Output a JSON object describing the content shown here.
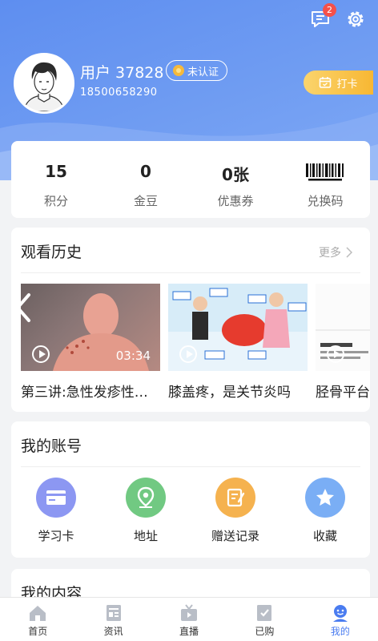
{
  "header": {
    "message_badge": "2",
    "username": "用户 37828",
    "verify_label": "未认证",
    "phone": "18500658290",
    "checkin_label": "打卡"
  },
  "stats": [
    {
      "value": "15",
      "label": "积分"
    },
    {
      "value": "0",
      "label": "金豆"
    },
    {
      "value": "0张",
      "label": "优惠券"
    },
    {
      "value": "",
      "label": "兑换码"
    }
  ],
  "history": {
    "title": "观看历史",
    "more_label": "更多",
    "items": [
      {
        "title": "第三讲:急性发疹性疾病",
        "duration": "03:34"
      },
      {
        "title": "膝盖疼，是关节炎吗",
        "duration": ""
      },
      {
        "title": "胫骨平台骨折",
        "duration": ""
      }
    ]
  },
  "account": {
    "title": "我的账号",
    "items": [
      {
        "label": "学习卡",
        "icon": "card-icon",
        "color": "#8c97f2"
      },
      {
        "label": "地址",
        "icon": "location-icon",
        "color": "#71c982"
      },
      {
        "label": "赠送记录",
        "icon": "note-icon",
        "color": "#f5b24f"
      },
      {
        "label": "收藏",
        "icon": "star-icon",
        "color": "#7aaef5"
      }
    ]
  },
  "content": {
    "title": "我的内容"
  },
  "tabbar": [
    {
      "label": "首页",
      "icon": "home-icon"
    },
    {
      "label": "资讯",
      "icon": "news-icon"
    },
    {
      "label": "直播",
      "icon": "live-icon"
    },
    {
      "label": "已购",
      "icon": "purchased-icon"
    },
    {
      "label": "我的",
      "icon": "profile-icon"
    }
  ],
  "colors": {
    "accent": "#4a7cf0",
    "header": "#6f9cf2",
    "checkin": "#f7b733"
  }
}
